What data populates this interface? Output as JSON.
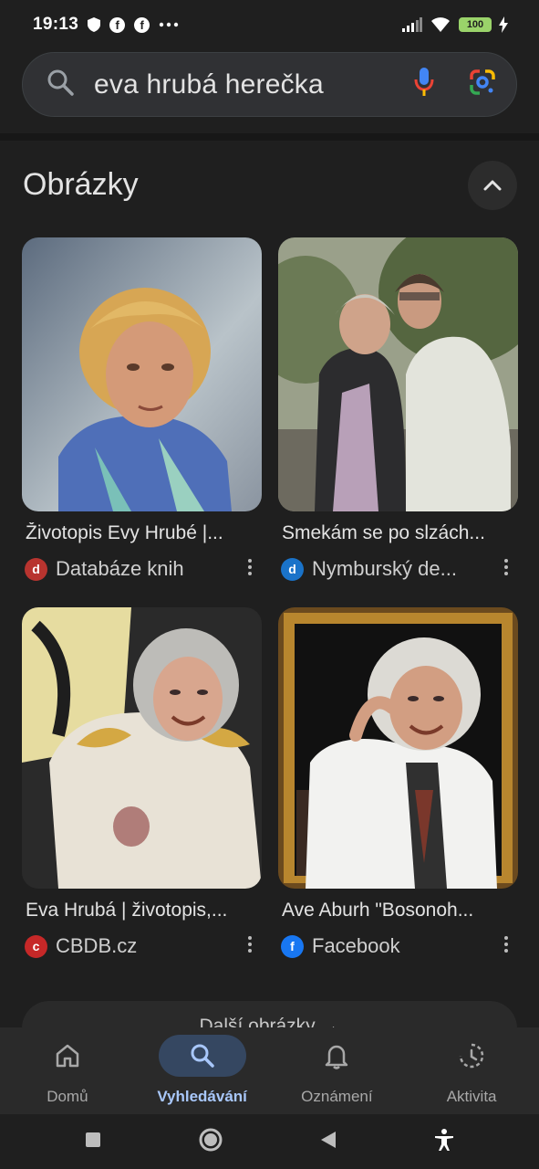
{
  "status_bar": {
    "time": "19:13",
    "battery": "100"
  },
  "search": {
    "query": "eva hrubá herečka"
  },
  "section": {
    "title": "Obrázky"
  },
  "results": [
    {
      "title": "Životopis Evy Hrubé |...",
      "source": "Databáze knih",
      "source_icon_color": "#b8342f"
    },
    {
      "title": "Smekám se po slzách...",
      "source": "Nymburský de...",
      "source_icon_color": "#1a73c9"
    },
    {
      "title": "Eva Hrubá | životopis,...",
      "source": "CBDB.cz",
      "source_icon_color": "#c62828"
    },
    {
      "title": "Ave Aburh \"Bosonoh...",
      "source": "Facebook",
      "source_icon_color": "#1877f2"
    }
  ],
  "more_images": {
    "label": "Další obrázky →"
  },
  "bottom_nav": {
    "items": [
      {
        "label": "Domů",
        "icon": "home-icon"
      },
      {
        "label": "Vyhledávání",
        "icon": "search-icon"
      },
      {
        "label": "Oznámení",
        "icon": "bell-icon"
      },
      {
        "label": "Aktivita",
        "icon": "activity-icon"
      }
    ],
    "active_index": 1,
    "active_color": "#a8c7fa"
  },
  "colors": {
    "background": "#1f1f1f",
    "search_bar": "#303134",
    "accent": "#a8c7fa"
  }
}
